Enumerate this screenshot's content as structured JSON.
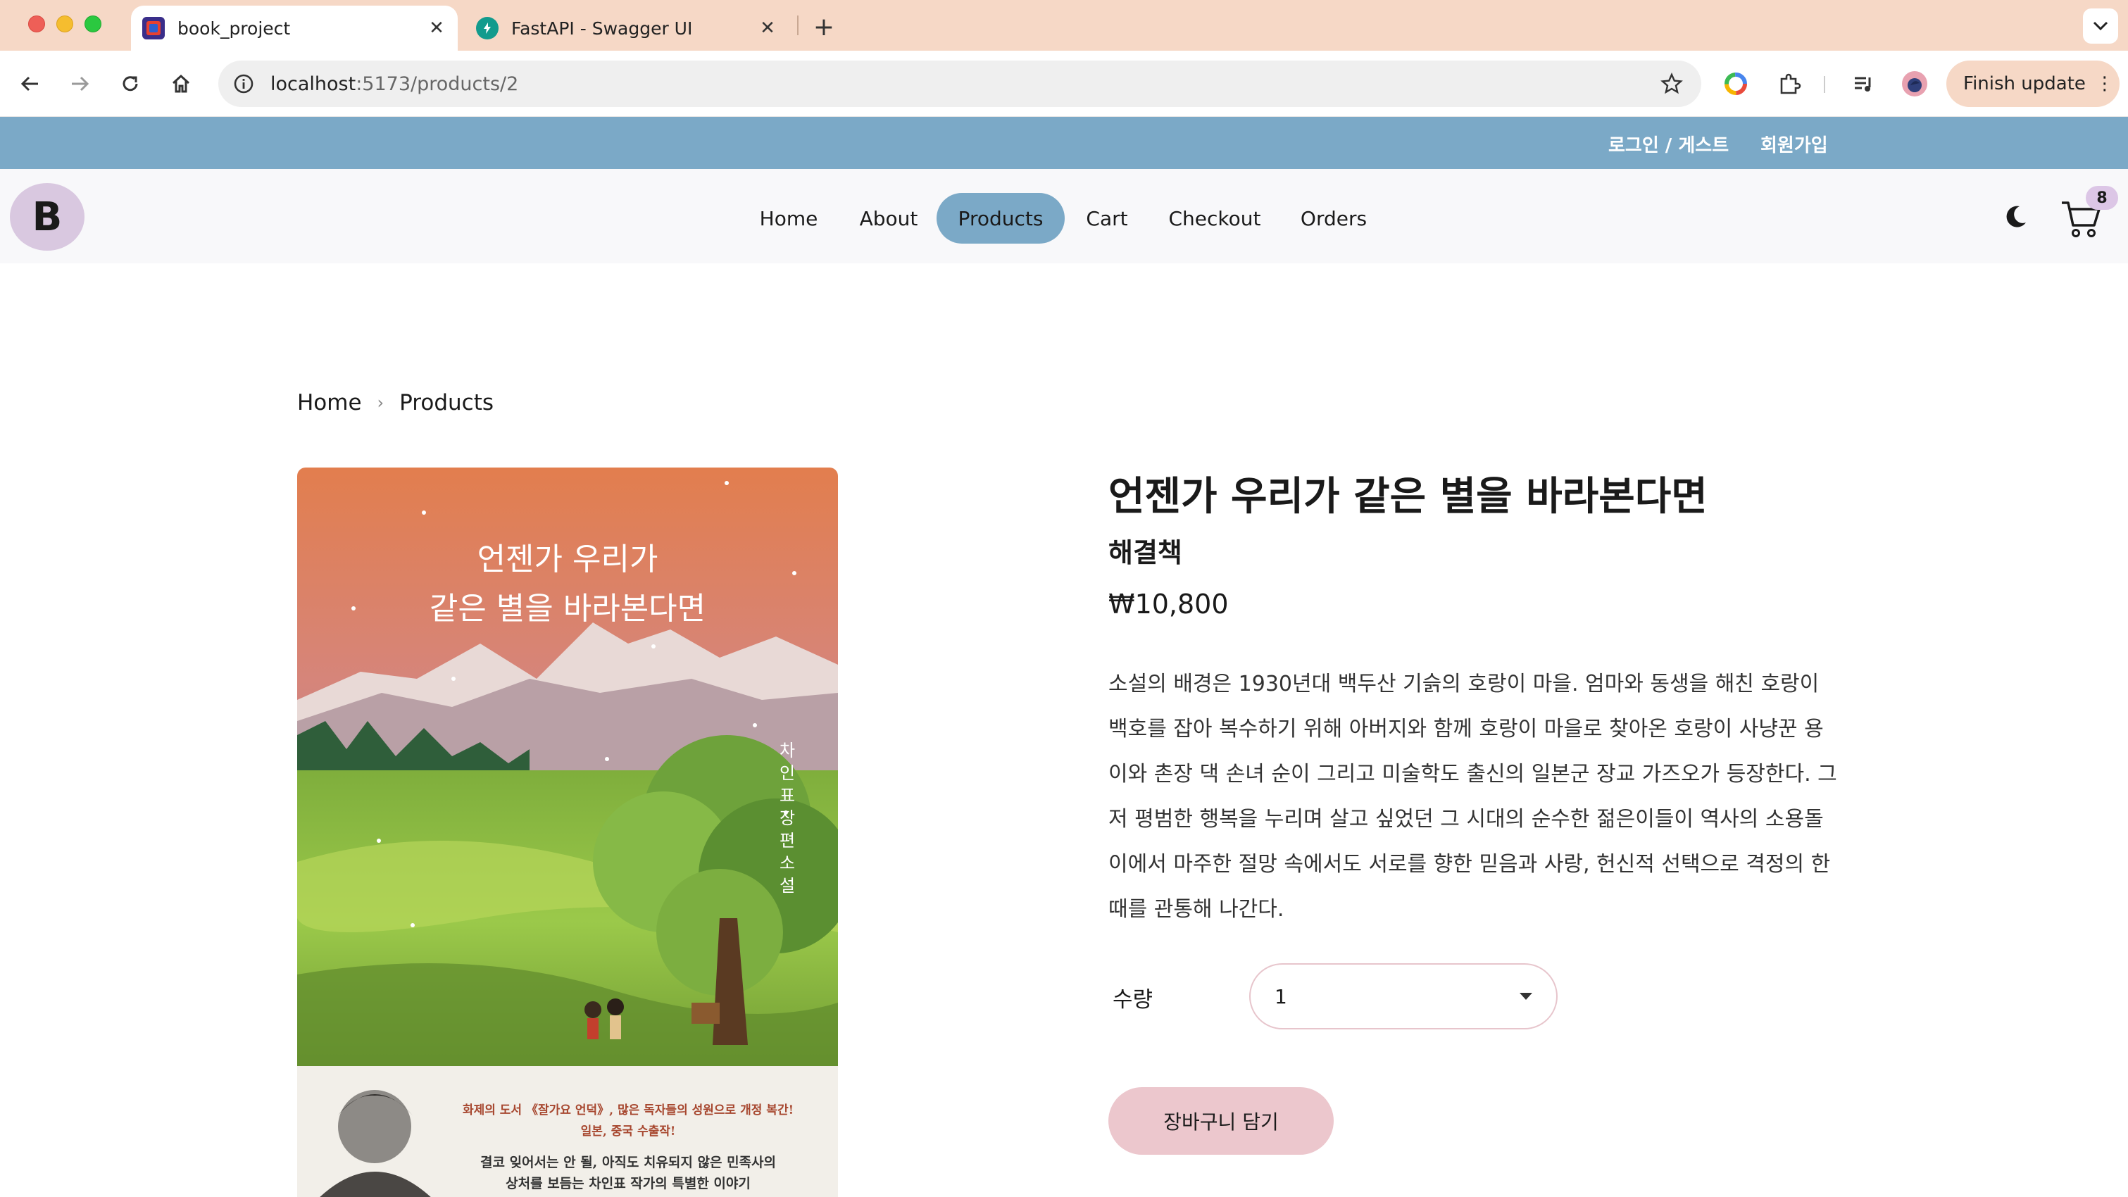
{
  "browser": {
    "tabs": [
      {
        "title": "book_project",
        "active": true
      },
      {
        "title": "FastAPI - Swagger UI",
        "active": false
      }
    ],
    "url_host": "localhost",
    "url_path": ":5173/products/2",
    "finish_update_label": "Finish update"
  },
  "site": {
    "top_links": {
      "login": "로그인 / 게스트",
      "signup": "회원가입"
    },
    "logo_letter": "B",
    "nav": [
      {
        "label": "Home",
        "active": false
      },
      {
        "label": "About",
        "active": false
      },
      {
        "label": "Products",
        "active": true
      },
      {
        "label": "Cart",
        "active": false
      },
      {
        "label": "Checkout",
        "active": false
      },
      {
        "label": "Orders",
        "active": false
      }
    ],
    "cart_count": "8",
    "accent_color": "#7ba9c7"
  },
  "breadcrumb": [
    "Home",
    "Products"
  ],
  "product": {
    "cover": {
      "title_line1": "언젠가 우리가",
      "title_line2": "같은 별을 바라본다면",
      "vertical_text": "차인표 장편소설",
      "tag_line1": "화제의 도서 《잘가요 언덕》, 많은 독자들의 성원으로 개정 복간!",
      "tag_line2": "일본, 중국 수출작!",
      "desc_line1": "결코 잊어서는 안 될, 아직도 치유되지 않은 민족사의",
      "desc_line2": "상처를 보듬는 차인표 작가의 특별한 이야기"
    },
    "title": "언젠가 우리가 같은 별을 바라본다면",
    "author": "해결책",
    "price": "₩10,800",
    "description": "소설의 배경은 1930년대 백두산 기슭의 호랑이 마을. 엄마와 동생을 해친 호랑이 백호를 잡아 복수하기 위해 아버지와 함께 호랑이 마을로 찾아온 호랑이 사냥꾼 용이와 촌장 댁 손녀 순이 그리고 미술학도 출신의 일본군 장교 가즈오가 등장한다. 그저 평범한 행복을 누리며 살고 싶었던 그 시대의 순수한 젊은이들이 역사의 소용돌이에서 마주한 절망 속에서도 서로를 향한 믿음과 사랑, 헌신적 선택으로 격정의 한 때를 관통해 나간다.",
    "quantity_label": "수량",
    "quantity_value": "1",
    "add_to_cart_label": "장바구니 담기"
  }
}
